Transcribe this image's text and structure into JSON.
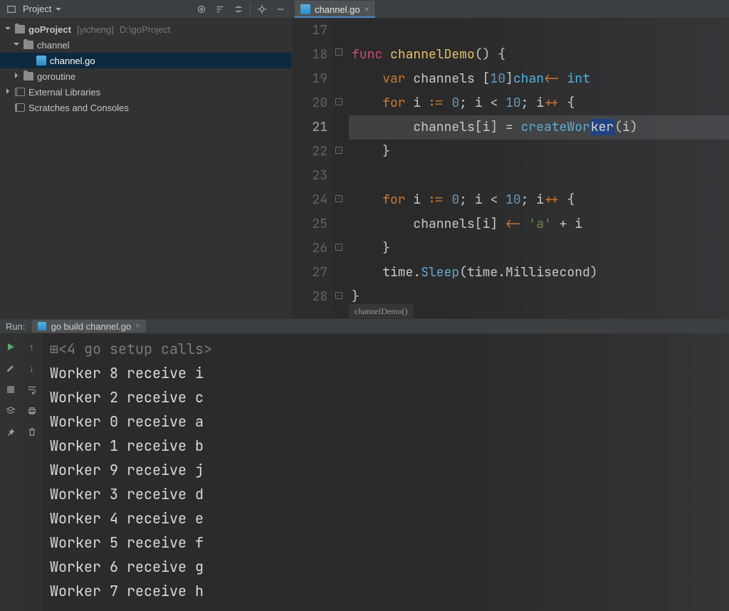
{
  "sidebar": {
    "title": "Project",
    "toolbar_icons": [
      "target-icon",
      "sort-icon",
      "expand-icon",
      "divider",
      "gear-icon",
      "minimize-icon"
    ]
  },
  "tree": {
    "root": {
      "label": "goProject",
      "branch": "[yicheng]",
      "path": "D:\\goProject"
    },
    "items": [
      {
        "label": "channel",
        "expanded": true,
        "depth": 1,
        "icon": "folder"
      },
      {
        "label": "channel.go",
        "selected": true,
        "depth": 2,
        "icon": "go"
      },
      {
        "label": "goroutine",
        "expanded": false,
        "depth": 1,
        "icon": "folder"
      },
      {
        "label": "External Libraries",
        "depth": 0,
        "icon": "lib"
      },
      {
        "label": "Scratches and Consoles",
        "depth": 0,
        "icon": "scratch"
      }
    ]
  },
  "tabs": [
    {
      "label": "channel.go",
      "active": true
    }
  ],
  "editor": {
    "first_line": 17,
    "highlight_line": 21,
    "selection": "ker",
    "breadcrumb": "channelDemo()",
    "lines": [
      {
        "n": 17,
        "code": ""
      },
      {
        "n": 18,
        "code": "func channelDemo() {"
      },
      {
        "n": 19,
        "code": "    var channels [10]chan<- int"
      },
      {
        "n": 20,
        "code": "    for i := 0; i < 10; i++ {"
      },
      {
        "n": 21,
        "code": "        channels[i] = createWorker(i)"
      },
      {
        "n": 22,
        "code": "    }"
      },
      {
        "n": 23,
        "code": ""
      },
      {
        "n": 24,
        "code": "    for i := 0; i < 10; i++ {"
      },
      {
        "n": 25,
        "code": "        channels[i] <- 'a' + i"
      },
      {
        "n": 26,
        "code": "    }"
      },
      {
        "n": 27,
        "code": "    time.Sleep(time.Millisecond)"
      },
      {
        "n": 28,
        "code": "}"
      }
    ]
  },
  "run": {
    "title": "Run:",
    "tab": "go build channel.go",
    "gutter_icons_left": [
      "play-icon",
      "wrench-icon",
      "stop-icon",
      "layers-icon",
      "pin-icon"
    ],
    "gutter_icons_right": [
      "up-icon",
      "down-icon",
      "wrap-icon",
      "print-icon",
      "trash-icon"
    ],
    "output": [
      "<4 go setup calls>",
      "Worker 8 receive i",
      "Worker 2 receive c",
      "Worker 0 receive a",
      "Worker 1 receive b",
      "Worker 9 receive j",
      "Worker 3 receive d",
      "Worker 4 receive e",
      "Worker 5 receive f",
      "Worker 6 receive g",
      "Worker 7 receive h"
    ]
  }
}
